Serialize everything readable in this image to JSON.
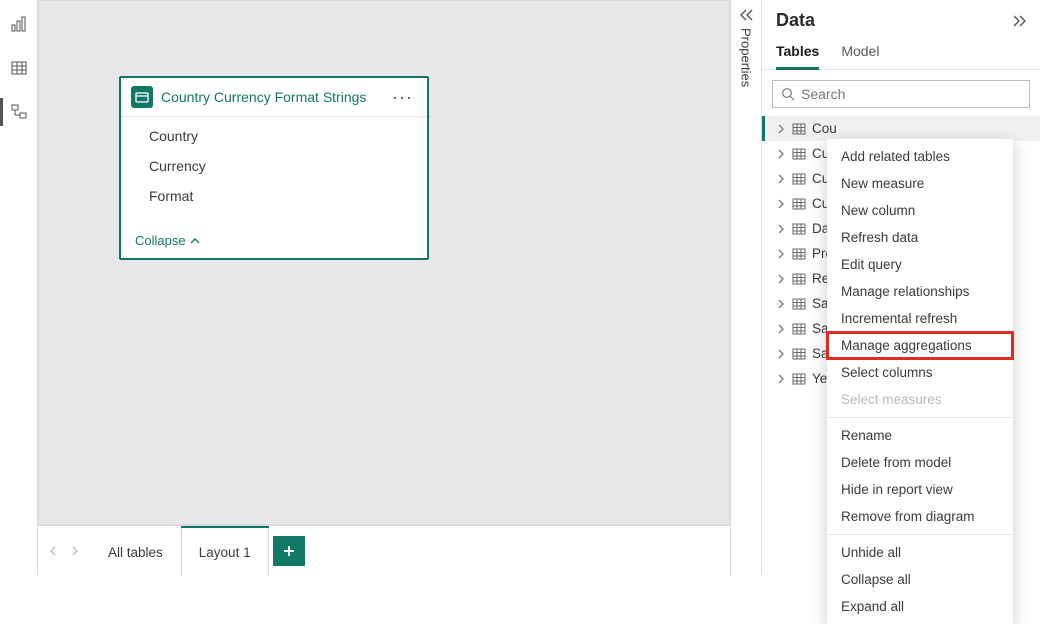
{
  "colors": {
    "accent": "#117865",
    "border": "#dcdcdc",
    "canvas_bg": "#e8e8e8",
    "highlight_red": "#e02b20"
  },
  "left_nav": {
    "items": [
      "report-view",
      "data-view",
      "model-view"
    ],
    "active_index": 2
  },
  "card": {
    "title": "Country Currency Format Strings",
    "fields": [
      "Country",
      "Currency",
      "Format"
    ],
    "footer_label": "Collapse"
  },
  "bottom_tabs": {
    "tabs": [
      "All tables",
      "Layout 1"
    ],
    "active_index": 1
  },
  "props_strip": {
    "label": "Properties"
  },
  "data_pane": {
    "title": "Data",
    "tabs": [
      "Tables",
      "Model"
    ],
    "active_tab_index": 0,
    "search_placeholder": "Search",
    "tables_truncated": [
      "Cou",
      "Cur",
      "Cur",
      "Cus",
      "Dat",
      "Pro",
      "Res",
      "Sal",
      "Sal",
      "Sal",
      "Yea"
    ],
    "selected_index": 0
  },
  "context_menu": {
    "items": [
      {
        "label": "Add related tables",
        "enabled": true
      },
      {
        "label": "New measure",
        "enabled": true
      },
      {
        "label": "New column",
        "enabled": true
      },
      {
        "label": "Refresh data",
        "enabled": true
      },
      {
        "label": "Edit query",
        "enabled": true
      },
      {
        "label": "Manage relationships",
        "enabled": true
      },
      {
        "label": "Incremental refresh",
        "enabled": true
      },
      {
        "label": "Manage aggregations",
        "enabled": true,
        "highlighted": true
      },
      {
        "label": "Select columns",
        "enabled": true
      },
      {
        "label": "Select measures",
        "enabled": false
      },
      {
        "label": "Rename",
        "enabled": true
      },
      {
        "label": "Delete from model",
        "enabled": true
      },
      {
        "label": "Hide in report view",
        "enabled": true
      },
      {
        "label": "Remove from diagram",
        "enabled": true
      },
      {
        "label": "Unhide all",
        "enabled": true
      },
      {
        "label": "Collapse all",
        "enabled": true
      },
      {
        "label": "Expand all",
        "enabled": true
      }
    ],
    "separators_after_index": [
      9,
      13
    ]
  }
}
